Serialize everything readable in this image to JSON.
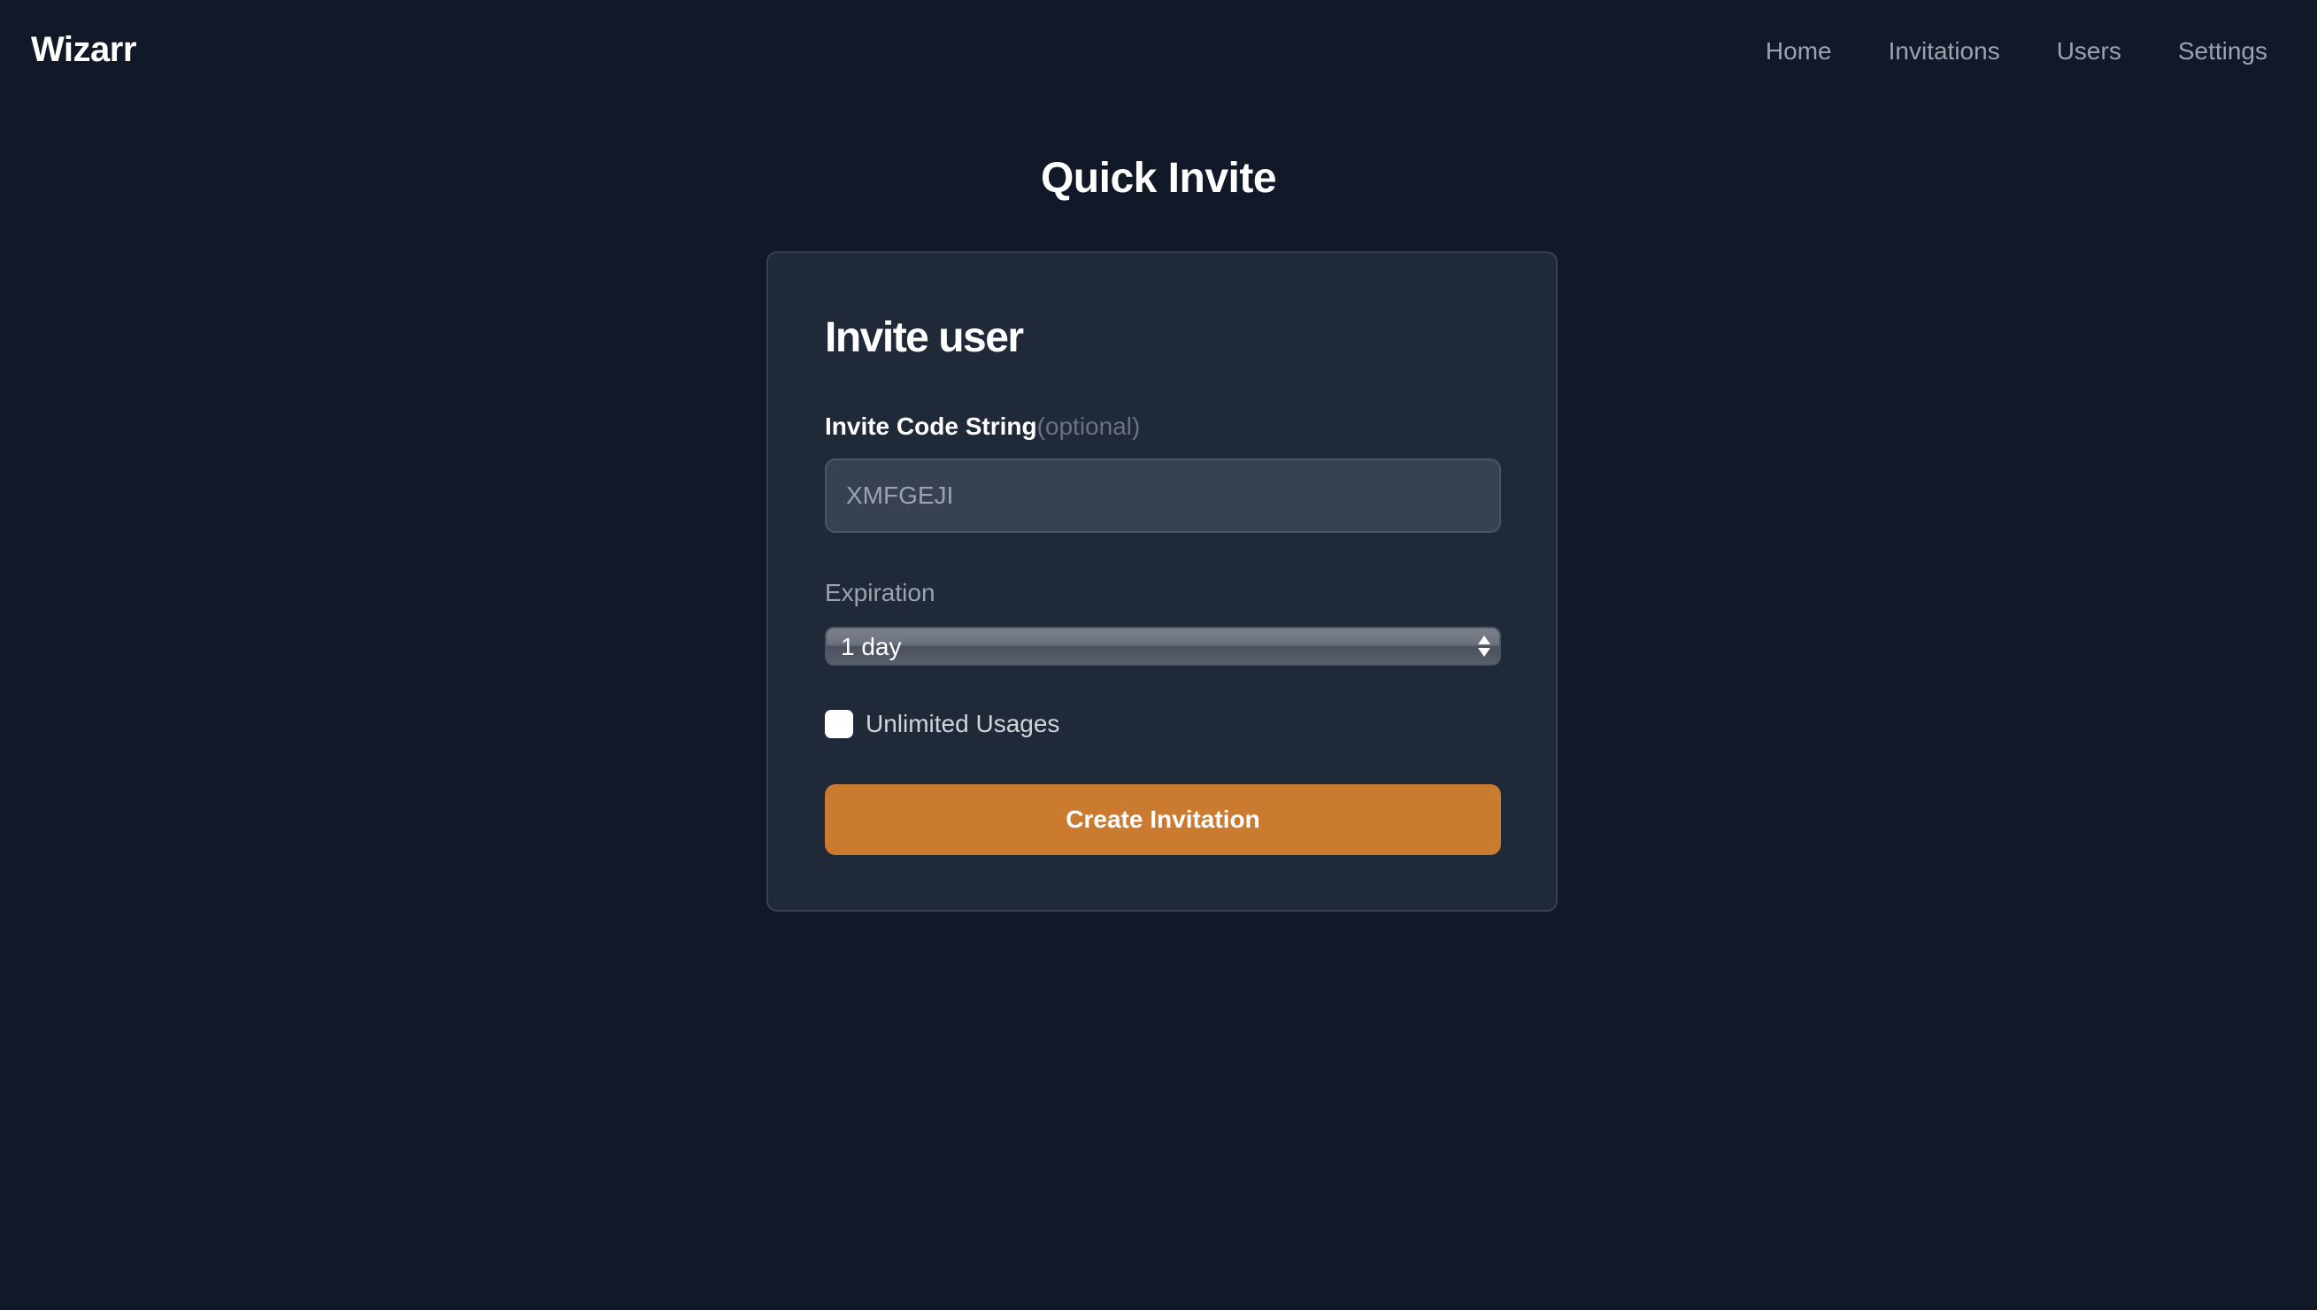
{
  "navbar": {
    "brand": "Wizarr",
    "links": [
      {
        "label": "Home"
      },
      {
        "label": "Invitations"
      },
      {
        "label": "Users"
      },
      {
        "label": "Settings"
      }
    ]
  },
  "page": {
    "title": "Quick Invite"
  },
  "card": {
    "title": "Invite user",
    "code_label": "Invite Code String",
    "code_optional": "(optional)",
    "code_placeholder": "XMFGEJI",
    "code_value": "",
    "expiration_label": "Expiration",
    "expiration_selected": "1 day",
    "unlimited_label": "Unlimited Usages",
    "unlimited_checked": false,
    "create_button": "Create Invitation"
  },
  "colors": {
    "background": "#111827",
    "card": "#1f2937",
    "accent": "#cb7b30",
    "muted_text": "#9ca3af"
  }
}
